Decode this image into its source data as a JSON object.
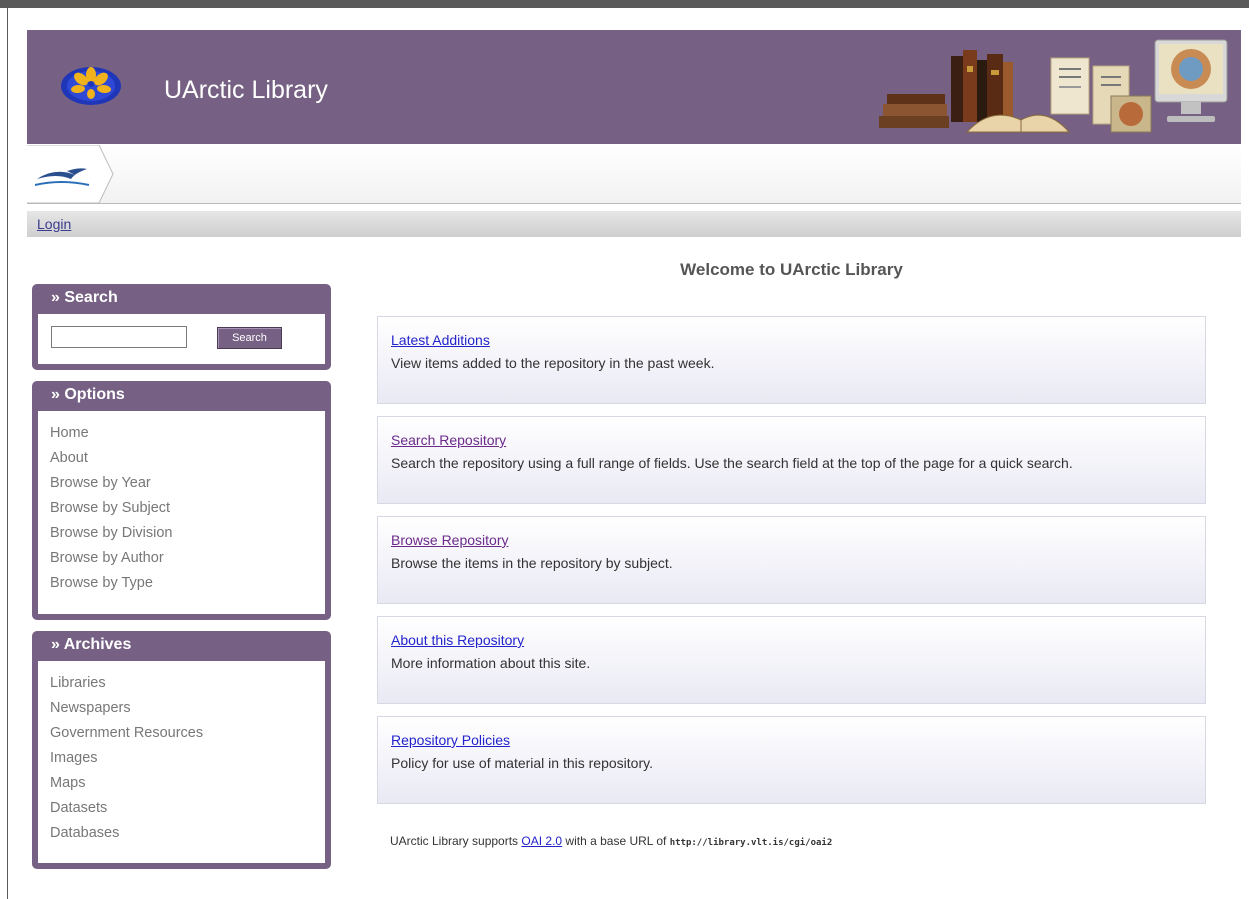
{
  "header": {
    "title": "UArctic Library"
  },
  "nav": {
    "login": "Login"
  },
  "search": {
    "title": "» Search",
    "input_value": "",
    "button": "Search"
  },
  "options": {
    "title": "» Options",
    "items": [
      "Home",
      "About",
      "Browse by Year",
      "Browse by Subject",
      "Browse by Division",
      "Browse by Author",
      "Browse by Type"
    ]
  },
  "archives": {
    "title": "» Archives",
    "items": [
      "Libraries",
      "Newspapers",
      "Government Resources",
      "Images",
      "Maps",
      "Datasets",
      "Databases"
    ]
  },
  "main": {
    "welcome": "Welcome to UArctic Library",
    "cards": [
      {
        "link": "Latest Additions",
        "desc": "View items added to the repository in the past week."
      },
      {
        "link": "Search Repository",
        "desc": "Search the repository using a full range of fields. Use the search field at the top of the page for a quick search."
      },
      {
        "link": "Browse Repository",
        "desc": "Browse the items in the repository by subject."
      },
      {
        "link": "About this Repository",
        "desc": "More information about this site."
      },
      {
        "link": "Repository Policies",
        "desc": "Policy for use of material in this repository."
      }
    ]
  },
  "footer": {
    "prefix": "UArctic Library supports",
    "oai_link": "OAI 2.0",
    "middle": "with a base URL of",
    "url": "http://library.vlt.is/cgi/oai2"
  },
  "colors": {
    "brand": "#766083",
    "link": "#2323cc",
    "visited_link": "#6b2a8b"
  },
  "icons": {
    "logo": "uarctic-logo",
    "home": "bird-home-icon"
  }
}
